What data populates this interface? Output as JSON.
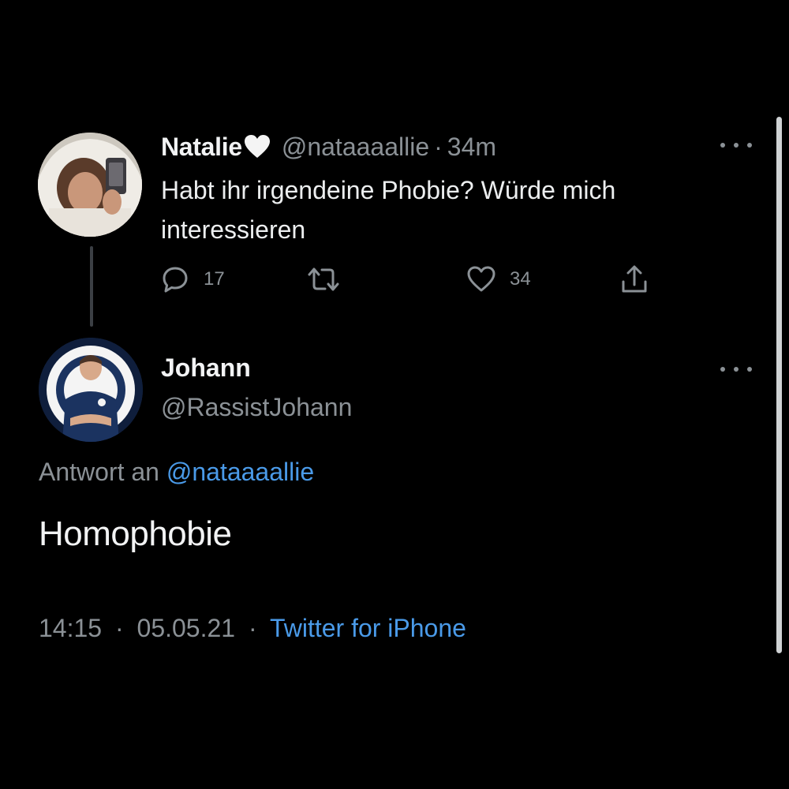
{
  "parent_tweet": {
    "display_name": "Natalie",
    "name_emoji": "white-heart-icon",
    "handle": "@nataaaallie",
    "separator": "·",
    "time_ago": "34m",
    "text": "Habt ihr irgendeine Phobie? Würde mich interessieren",
    "reply_count": "17",
    "retweet_count": "",
    "like_count": "34"
  },
  "reply_tweet": {
    "display_name": "Johann",
    "handle": "@RassistJohann",
    "reply_prefix": "Antwort an",
    "reply_to_handle": "@nataaaallie",
    "text": "Homophobie",
    "time": "14:15",
    "separator": "·",
    "date": "05.05.21",
    "source": "Twitter for iPhone"
  },
  "icons": {
    "more": "more-horizontal-icon",
    "reply": "comment-bubble-icon",
    "retweet": "retweet-icon",
    "like": "heart-outline-icon",
    "share": "share-upload-icon"
  },
  "colors": {
    "background": "#000000",
    "text_primary": "#f2f3f4",
    "text_muted": "#8b9196",
    "link": "#4a9ae8",
    "thread_line": "#3b3f44"
  }
}
